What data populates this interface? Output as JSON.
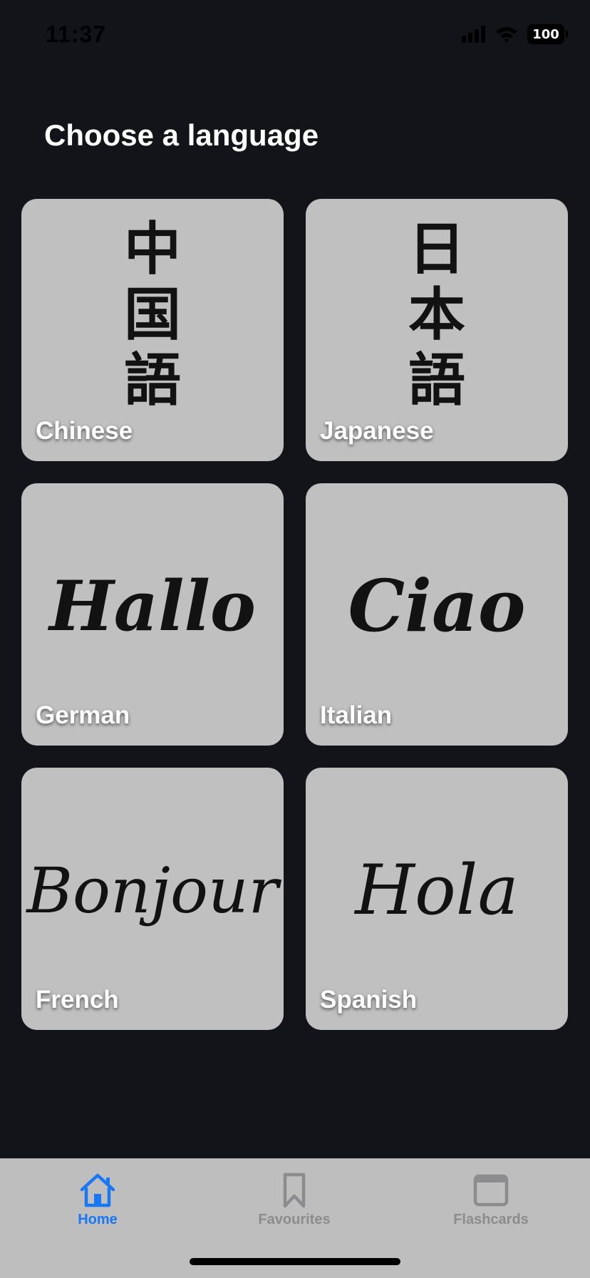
{
  "status_bar": {
    "time": "11:37",
    "battery_level": "100",
    "icons": [
      "cellular-signal-icon",
      "wifi-icon",
      "battery-icon"
    ]
  },
  "header": {
    "title": "Choose a language"
  },
  "languages": [
    {
      "label": "Chinese",
      "art_lines": [
        "中",
        "国",
        "語"
      ]
    },
    {
      "label": "Japanese",
      "art_lines": [
        "日",
        "本",
        "語"
      ]
    },
    {
      "label": "German",
      "art_text": "Hallo"
    },
    {
      "label": "Italian",
      "art_text": "Ciao"
    },
    {
      "label": "French",
      "art_text": "Bonjour"
    },
    {
      "label": "Spanish",
      "art_text": "Hola"
    }
  ],
  "tab_bar": {
    "items": [
      {
        "label": "Home",
        "icon": "home-icon",
        "active": true
      },
      {
        "label": "Favourites",
        "icon": "bookmark-icon",
        "active": false
      },
      {
        "label": "Flashcards",
        "icon": "flashcards-icon",
        "active": false
      }
    ]
  },
  "colors": {
    "background": "#12141a",
    "card": "#c0c0c0",
    "accent": "#1877f2",
    "tab_inactive": "#8c8c8f",
    "tab_bar": "#bebebf"
  }
}
